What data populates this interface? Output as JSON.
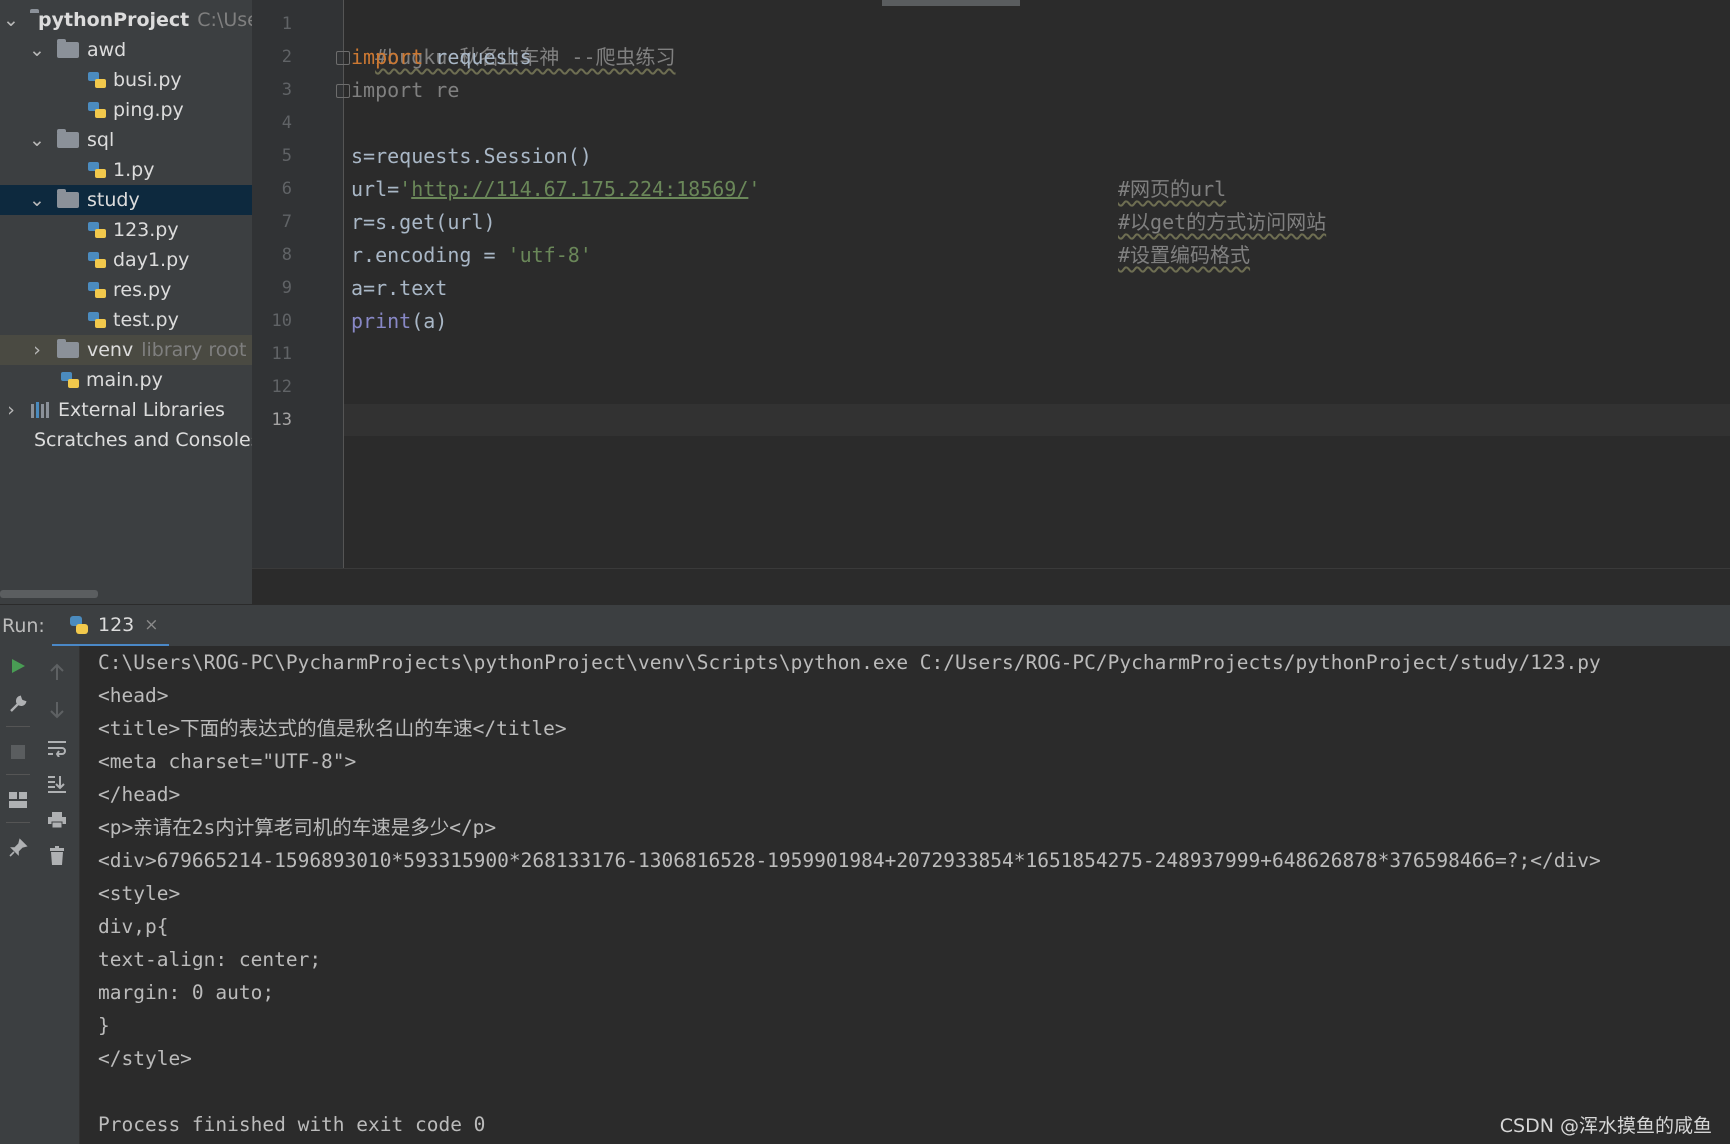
{
  "project_tree": {
    "root": {
      "label": "pythonProject",
      "path_hint": "C:\\User"
    },
    "items": [
      {
        "label": "awd",
        "kind": "folder",
        "expanded": true
      },
      {
        "label": "busi.py",
        "kind": "python-file"
      },
      {
        "label": "ping.py",
        "kind": "python-file"
      },
      {
        "label": "sql",
        "kind": "folder",
        "expanded": true
      },
      {
        "label": "1.py",
        "kind": "python-file"
      },
      {
        "label": "study",
        "kind": "folder",
        "expanded": true,
        "selected": true
      },
      {
        "label": "123.py",
        "kind": "python-file"
      },
      {
        "label": "day1.py",
        "kind": "python-file"
      },
      {
        "label": "res.py",
        "kind": "python-file"
      },
      {
        "label": "test.py",
        "kind": "python-file"
      },
      {
        "label": "venv",
        "kind": "folder",
        "expanded": false,
        "hint": "library root"
      },
      {
        "label": "main.py",
        "kind": "python-file"
      },
      {
        "label": "External Libraries",
        "kind": "libraries"
      },
      {
        "label": "Scratches and Consoles",
        "kind": "scratches"
      }
    ]
  },
  "editor": {
    "line_numbers": [
      "1",
      "2",
      "3",
      "4",
      "5",
      "6",
      "7",
      "8",
      "9",
      "10",
      "11",
      "12",
      "13"
    ],
    "current_line": 13,
    "code": {
      "l1_comment": "#bugku 秋名山车神 --爬虫练习",
      "l2_kw": "import",
      "l2_rest": " requests",
      "l3_text": "import re",
      "l5_text": "s=requests.Session()",
      "l6_pre": "url=",
      "l6_q1": "'",
      "l6_url": "http://114.67.175.224:18569/",
      "l6_q2": "'",
      "l6_comment": "#网页的url",
      "l7_text": "r=s.get(url)",
      "l7_comment": "#以get的方式访问网站",
      "l8_pre": "r.encoding = ",
      "l8_str": "'utf-8'",
      "l8_comment": "#设置编码格式",
      "l9_text": "a=r.text",
      "l10_builtin": "print",
      "l10_rest": "(a)"
    }
  },
  "run_panel": {
    "label": "Run:",
    "tab_label": "123",
    "tab_close": "×",
    "output_lines": [
      "C:\\Users\\ROG-PC\\PycharmProjects\\pythonProject\\venv\\Scripts\\python.exe C:/Users/ROG-PC/PycharmProjects/pythonProject/study/123.py",
      "<head>",
      "<title>下面的表达式的值是秋名山的车速</title>",
      "<meta charset=\"UTF-8\">",
      "</head>",
      "<p>亲请在2s内计算老司机的车速是多少</p>",
      "<div>679665214-1596893010*593315900*268133176-1306816528-1959901984+2072933854*1651854275-248937999+648626878*376598466=?;</div>",
      "<style>",
      "div,p{",
      "text-align: center;",
      "margin: 0 auto;",
      "}",
      "</style>",
      "",
      "Process finished with exit code 0"
    ],
    "toolbar_icons": [
      "run-icon",
      "wrench-icon",
      "stop-icon",
      "layout-icon",
      "pin-icon",
      "up-arrow-icon",
      "down-arrow-icon",
      "soft-wrap-icon",
      "scroll-to-end-icon",
      "print-icon",
      "trash-icon"
    ]
  },
  "watermark": "CSDN @浑水摸鱼的咸鱼",
  "colors": {
    "background": "#2b2b2b",
    "panel": "#3c3f41",
    "keyword": "#cc7832",
    "string": "#6a8759",
    "comment": "#808080",
    "builtin": "#8888c6",
    "selection": "#0d293e",
    "tab_underline": "#4a88c7"
  }
}
